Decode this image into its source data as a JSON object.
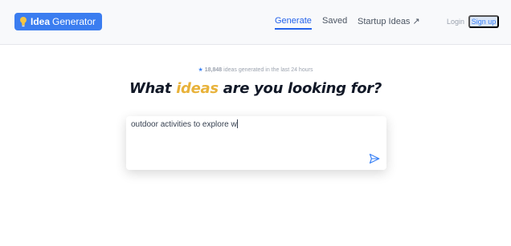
{
  "header": {
    "logo": {
      "word1": "Idea",
      "word2": "Generator",
      "icon": "lightbulb-icon"
    },
    "nav": [
      {
        "label": "Generate",
        "active": true
      },
      {
        "label": "Saved",
        "active": false
      },
      {
        "label": "Startup Ideas ↗",
        "active": false
      }
    ],
    "login_label": "Login",
    "signup_label": "Sign up"
  },
  "main": {
    "stats_count": "18,848",
    "stats_suffix": "ideas generated in the last 24 hours",
    "headline_pre": "What",
    "headline_accent": "ideas",
    "headline_post": "are you looking for?",
    "input_value": "outdoor activities to explore w",
    "send_icon": "send-icon"
  },
  "colors": {
    "accent": "#3b7df0",
    "highlight": "#e8b23a"
  }
}
